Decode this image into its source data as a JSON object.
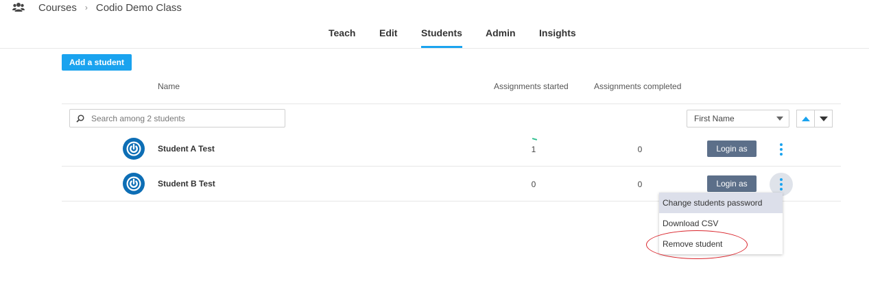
{
  "breadcrumb": {
    "icon": "users-icon",
    "items": [
      "Courses",
      "Codio Demo Class"
    ],
    "separator": "›"
  },
  "tabs": [
    {
      "label": "Teach",
      "active": false
    },
    {
      "label": "Edit",
      "active": false
    },
    {
      "label": "Students",
      "active": true
    },
    {
      "label": "Admin",
      "active": false
    },
    {
      "label": "Insights",
      "active": false
    }
  ],
  "toolbar": {
    "add_student_label": "Add a student"
  },
  "columns": {
    "name": "Name",
    "started": "Assignments started",
    "completed": "Assignments completed"
  },
  "search": {
    "placeholder": "Search among 2 students",
    "value": ""
  },
  "sort": {
    "selected": "First Name",
    "ascending_icon": "triangle-up-icon",
    "descending_icon": "triangle-down-icon"
  },
  "students": [
    {
      "name": "Student A Test",
      "started": "1",
      "completed": "0",
      "login_label": "Login as"
    },
    {
      "name": "Student B Test",
      "started": "0",
      "completed": "0",
      "login_label": "Login as"
    }
  ],
  "context_menu": {
    "items": [
      "Change students password",
      "Download CSV",
      "Remove student"
    ],
    "highlighted": "Change students password"
  },
  "colors": {
    "accent": "#1aa3ef",
    "login_button": "#5c6f89",
    "avatar": "#0d6eb5",
    "annotation": "#d9232a"
  }
}
